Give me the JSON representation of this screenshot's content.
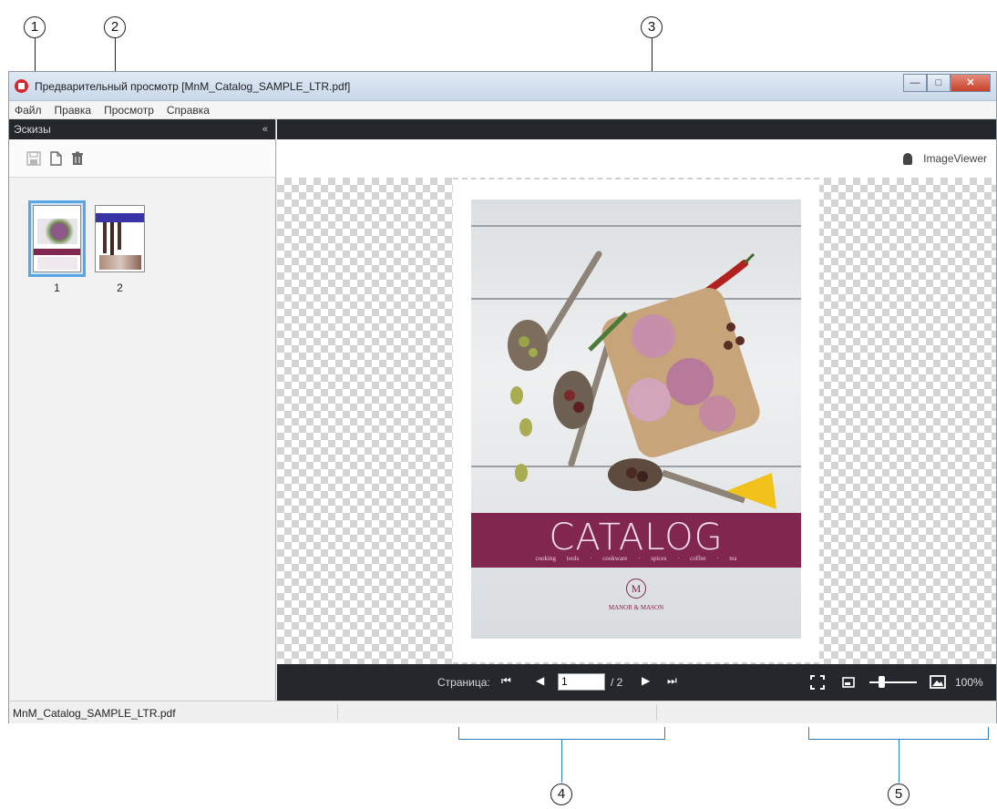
{
  "callouts": [
    "1",
    "2",
    "3",
    "4",
    "5"
  ],
  "window": {
    "title": "Предварительный просмотр [MnM_Catalog_SAMPLE_LTR.pdf]",
    "buttons": {
      "minimize": "—",
      "maximize": "□",
      "close": "✕"
    }
  },
  "menu": [
    "Файл",
    "Правка",
    "Просмотр",
    "Справка"
  ],
  "thumbnails_panel": {
    "title": "Эскизы",
    "collapse_glyph": "«",
    "toolbar_icons": [
      "save-icon",
      "document-icon",
      "trash-icon"
    ],
    "pages": [
      {
        "number": "1",
        "selected": true
      },
      {
        "number": "2",
        "selected": false
      }
    ]
  },
  "viewer": {
    "brand": "ImageViewer",
    "cover": {
      "title": "CATALOG",
      "subtitle": "cooking tools · cookware · spices · coffee · tea",
      "logo_letter": "M",
      "brand_name": "MANOR & MASON",
      "accent_color": "#80264f"
    }
  },
  "navigation": {
    "label": "Страница:",
    "current_page": "1",
    "total": "/ 2",
    "first_glyph": "⏮",
    "prev_glyph": "◀",
    "next_glyph": "▶",
    "last_glyph": "⏭",
    "zoom_level": "100%"
  },
  "status": {
    "filename": "MnM_Catalog_SAMPLE_LTR.pdf"
  }
}
